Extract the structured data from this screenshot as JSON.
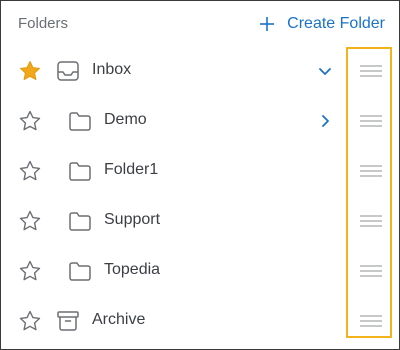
{
  "header": {
    "title": "Folders",
    "create_label": "Create Folder"
  },
  "folders": [
    {
      "label": "Inbox",
      "starred": true,
      "icon": "inbox-icon",
      "chevron": "chevron-down-icon"
    },
    {
      "label": "Demo",
      "starred": false,
      "icon": "folder-icon",
      "chevron": "chevron-right-icon"
    },
    {
      "label": "Folder1",
      "starred": false,
      "icon": "folder-icon",
      "chevron": ""
    },
    {
      "label": "Support",
      "starred": false,
      "icon": "folder-icon",
      "chevron": ""
    },
    {
      "label": "Topedia",
      "starred": false,
      "icon": "folder-icon",
      "chevron": ""
    },
    {
      "label": "Archive",
      "starred": false,
      "icon": "archive-icon",
      "chevron": ""
    }
  ],
  "colors": {
    "accent": "#1a73c9",
    "star_active": "#f0a81a",
    "highlight_border": "#f4b21b",
    "icon_gray": "#6b6f73"
  }
}
